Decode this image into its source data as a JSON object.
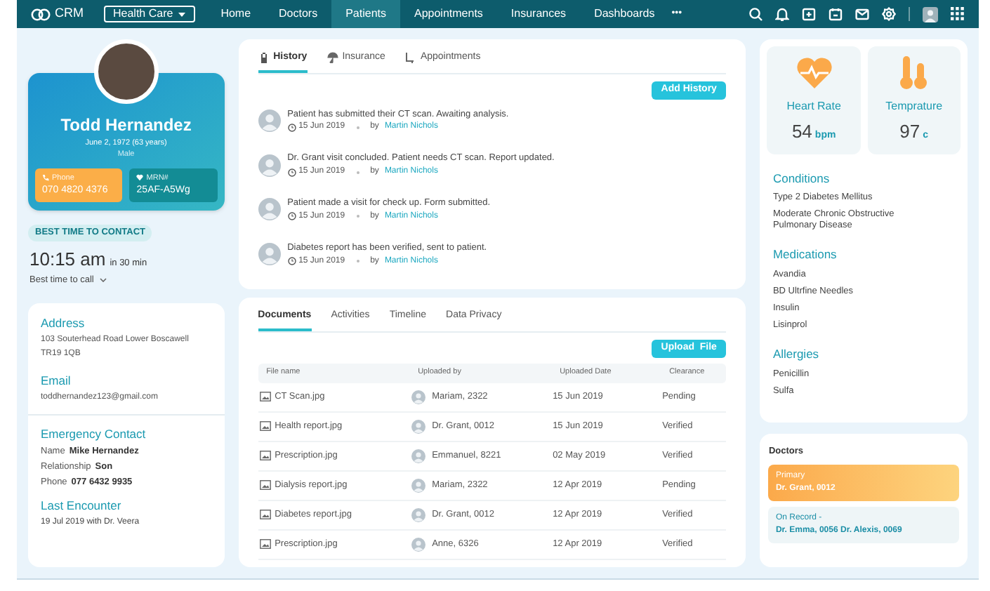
{
  "nav": {
    "logo": "CRM",
    "dropdown": "Health Care",
    "items": [
      {
        "label": "Home",
        "selected": false
      },
      {
        "label": "Doctors",
        "selected": false
      },
      {
        "label": "Patients",
        "selected": true
      },
      {
        "label": "Appointments",
        "selected": false
      },
      {
        "label": "Insurances",
        "selected": false
      },
      {
        "label": "Dashboards",
        "selected": false
      }
    ],
    "more": "•••"
  },
  "patient": {
    "name": "Todd Hernandez",
    "dob": "June 2, 1972 (63 years)",
    "sex": "Male",
    "phone_label": "Phone",
    "phone": "070 4820 4376",
    "mrn_label": "MRN#",
    "mrn": "25AF-A5Wg"
  },
  "contact_time": {
    "badge": "BEST TIME TO CONTACT",
    "time": "10:15 am",
    "relative": "in 30 min",
    "label": "Best time to call"
  },
  "details": [
    {
      "title": "Address",
      "lines": [
        "103  Souterhead Road Lower Boscawell",
        "TR19 1QB"
      ]
    },
    {
      "title": "Email",
      "lines": [
        "toddhernandez123@gmail.com"
      ]
    }
  ],
  "emergency": {
    "title": "Emergency Contact",
    "fields": [
      {
        "label": "Name",
        "value": "Mike Hernandez"
      },
      {
        "label": "Relationship",
        "value": "Son"
      },
      {
        "label": "Phone",
        "value": "077 6432 9935"
      }
    ]
  },
  "last_encounter": {
    "title": "Last Encounter",
    "text": "19 Jul 2019 with Dr. Veera"
  },
  "history": {
    "tabs": [
      {
        "label": "History",
        "selected": true
      },
      {
        "label": "Insurance",
        "selected": false
      },
      {
        "label": "Appointments",
        "selected": false
      }
    ],
    "button": "Add History",
    "items": [
      {
        "text": "Patient has submitted their CT scan. Awaiting analysis.",
        "date": "15 Jun 2019",
        "by": "by",
        "author": "Martin Nichols"
      },
      {
        "text": "Dr. Grant visit concluded. Patient needs CT scan. Report updated.",
        "date": "15 Jun 2019",
        "by": "by",
        "author": "Martin Nichols"
      },
      {
        "text": "Patient made a visit for check up. Form submitted.",
        "date": "15 Jun 2019",
        "by": "by",
        "author": "Martin Nichols"
      },
      {
        "text": "Diabetes report has been verified, sent to patient.",
        "date": "15 Jun 2019",
        "by": "by",
        "author": "Martin Nichols"
      }
    ]
  },
  "documents": {
    "tabs": [
      {
        "label": "Documents",
        "selected": true
      },
      {
        "label": "Activities",
        "selected": false
      },
      {
        "label": "Timeline",
        "selected": false
      },
      {
        "label": "Data Privacy",
        "selected": false
      }
    ],
    "button": "Upload  File",
    "columns": [
      "File name",
      "Uploaded by",
      "Uploaded Date",
      "Clearance"
    ],
    "rows": [
      {
        "file": "CT Scan.jpg",
        "uploader": "Mariam, 2322",
        "date": "15 Jun 2019",
        "clearance": "Pending"
      },
      {
        "file": "Health report.jpg",
        "uploader": "Dr. Grant, 0012",
        "date": "15 Jun 2019",
        "clearance": "Verified"
      },
      {
        "file": "Prescription.jpg",
        "uploader": "Emmanuel, 8221",
        "date": "02 May 2019",
        "clearance": "Verified"
      },
      {
        "file": "Dialysis report.jpg",
        "uploader": "Mariam, 2322",
        "date": "12 Apr 2019",
        "clearance": "Pending"
      },
      {
        "file": "Diabetes report.jpg",
        "uploader": "Dr. Grant, 0012",
        "date": "12 Apr 2019",
        "clearance": "Verified"
      },
      {
        "file": "Prescription.jpg",
        "uploader": "Anne, 6326",
        "date": "12 Apr 2019",
        "clearance": "Verified"
      }
    ]
  },
  "vitals": [
    {
      "kind": "heart",
      "label": "Heart Rate",
      "value": "54",
      "unit": "bpm"
    },
    {
      "kind": "temperature",
      "label": "Temprature",
      "value": "97",
      "unit": "c"
    }
  ],
  "sections": [
    {
      "title": "Conditions",
      "items": [
        "Type 2 Diabetes Mellitus",
        "Moderate Chronic Obstructive Pulmonary Disease"
      ]
    },
    {
      "title": "Medications",
      "items": [
        "Avandia",
        "BD Ultrfine Needles",
        "Insulin",
        "Lisinprol"
      ]
    },
    {
      "title": "Allergies",
      "items": [
        "Penicillin",
        "Sulfa"
      ]
    }
  ],
  "doctors": {
    "title": "Doctors",
    "entries": [
      {
        "kind": "primary",
        "label": "Primary",
        "value": "Dr. Grant, 0012"
      },
      {
        "kind": "record",
        "label": "On Record -",
        "value": "Dr. Emma, 0056 Dr. Alexis, 0069"
      }
    ]
  }
}
